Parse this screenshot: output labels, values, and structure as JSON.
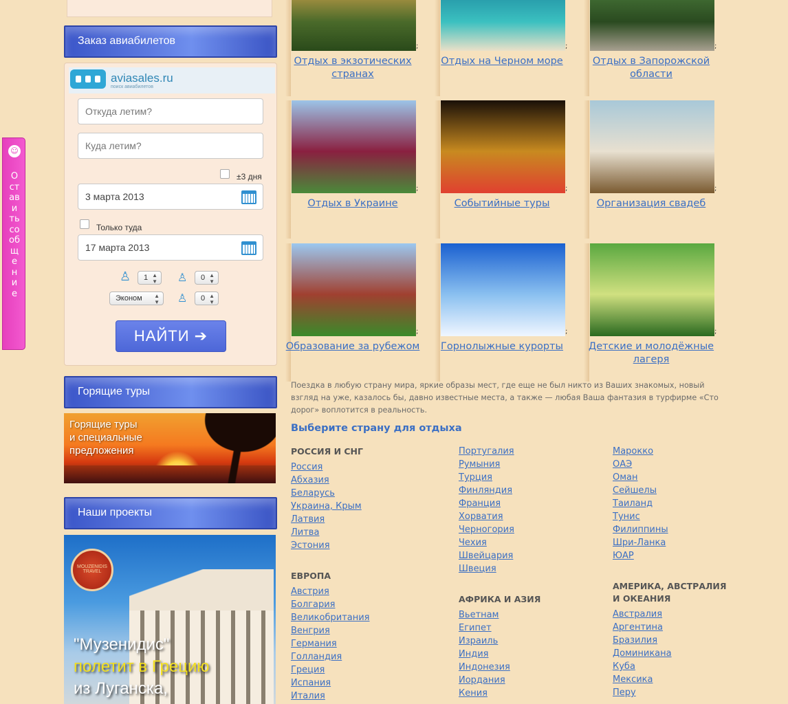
{
  "feedback": {
    "icon": "chat-icon",
    "label": "Оставить сообщение"
  },
  "sidebar": {
    "avia_title": "Заказ авиабилетов",
    "hot_title": "Горящие туры",
    "projects_title": "Наши проекты"
  },
  "avia": {
    "logo_text": "aviasales.ru",
    "logo_sub": "поиск авиабилетов",
    "from_placeholder": "Откуда летим?",
    "to_placeholder": "Куда летим?",
    "flex_label": "±3 дня",
    "date_out": "3 марта 2013",
    "oneway_label": "Только туда",
    "date_back": "17 марта 2013",
    "adults": "1",
    "children": "0",
    "class": "Эконом",
    "infants": "0",
    "search_button": "НАЙТИ ➔"
  },
  "hot_banner": {
    "line1": "Горящие туры",
    "line2": "и специальные",
    "line3": "предложения"
  },
  "projects_banner": {
    "seal": "MOUZENIDIS TRAVEL",
    "line1": "\"Музенидис\"",
    "line2": "полетит в Грецию",
    "line3": "из Луганска,"
  },
  "tiles": [
    {
      "label": "Отдых в экзотических странах",
      "photo_colors": [
        "#caa04a",
        "#4a6a2a",
        "#2a4a1a"
      ]
    },
    {
      "label": "Отдых на Черном море",
      "photo_colors": [
        "#1e8aa0",
        "#3bc0c0",
        "#eae0c8"
      ]
    },
    {
      "label": "Отдых в Запорожской области",
      "photo_colors": [
        "#4a7a3a",
        "#2a4a20",
        "#a8a090"
      ]
    },
    {
      "label": "Отдых в Украине",
      "photo_colors": [
        "#9cc4e8",
        "#8a2040",
        "#4a8a3a"
      ]
    },
    {
      "label": "Событийные туры",
      "photo_colors": [
        "#1a1008",
        "#c88a20",
        "#e04030"
      ]
    },
    {
      "label": "Организация свадеб",
      "photo_colors": [
        "#a8c8d8",
        "#e8e0d0",
        "#7a5a30"
      ]
    },
    {
      "label": "Образование за рубежом",
      "photo_colors": [
        "#9cc8f0",
        "#a04030",
        "#3a8a2a"
      ]
    },
    {
      "label": "Горнолыжные курорты",
      "photo_colors": [
        "#1a60d0",
        "#8ac0f0",
        "#f0f6ff"
      ]
    },
    {
      "label": "Детские и молодёжные лагеря",
      "photo_colors": [
        "#5aa840",
        "#d0e080",
        "#2a6a20"
      ]
    }
  ],
  "intro": "Поездка в любую страну мира, яркие образы мест, где еще не был никто из Ваших знакомых, новый взгляд на уже, казалось бы, давно известные места, а также — любая Ваша фантазия в турфирме «Сто дорог» воплотится в реальность.",
  "choose_title": "Выберите страну для отдыха",
  "regions": {
    "russia": {
      "title": "РОССИЯ И СНГ",
      "countries": [
        "Россия",
        "Абхазия",
        "Беларусь",
        "Украина, Крым",
        "Латвия",
        "Литва",
        "Эстония"
      ]
    },
    "europe": {
      "title": "ЕВРОПА",
      "countries": [
        "Австрия",
        "Болгария",
        "Великобритания",
        "Венгрия",
        "Германия",
        "Голландия",
        "Греция",
        "Испания",
        "Италия"
      ]
    },
    "europe2": {
      "countries": [
        "Португалия",
        "Румыния",
        "Турция",
        "Финляндия",
        "Франция",
        "Хорватия",
        "Черногория",
        "Чехия",
        "Швейцария",
        "Швеция"
      ]
    },
    "africa_asia": {
      "title": "АФРИКА И АЗИЯ",
      "countries": [
        "Вьетнам",
        "Египет",
        "Израиль",
        "Индия",
        "Индонезия",
        "Иордания",
        "Кения"
      ]
    },
    "africa_asia2": {
      "countries": [
        "Марокко",
        "ОАЭ",
        "Оман",
        "Сейшелы",
        "Таиланд",
        "Тунис",
        "Филиппины",
        "Шри-Ланка",
        "ЮАР"
      ]
    },
    "america": {
      "title": "АМЕРИКА, АВСТРАЛИЯ И ОКЕАНИЯ",
      "countries": [
        "Австралия",
        "Аргентина",
        "Бразилия",
        "Доминикана",
        "Куба",
        "Мексика",
        "Перу"
      ]
    }
  }
}
